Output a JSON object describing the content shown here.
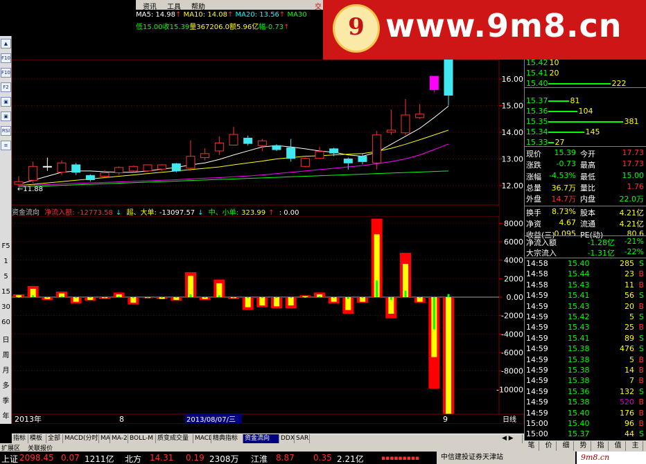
{
  "menubar": {
    "items": [
      "资讯",
      "工具",
      "帮助",
      "交"
    ]
  },
  "ma_line": {
    "ma5": "MA5: 14.98",
    "ma10": "MA10: 14.08",
    "ma20": "MA20: 13.56",
    "ma30": "MA30"
  },
  "info_line": {
    "low": "低15.00",
    "close": "收15.39",
    "vol": "量367206.0",
    "amount": "额5.96亿",
    "change": "幅-0.73"
  },
  "banner": {
    "seal_letter": "9",
    "site": "www.9m8.cn"
  },
  "left_tools": {
    "buttons": [
      "▲",
      "F10",
      "F10",
      "F2",
      "▣",
      "▣",
      "RSI",
      "≡"
    ],
    "labels": [
      "F5",
      "1",
      "5",
      "15",
      "30",
      "60",
      "日",
      "周",
      "月",
      "多",
      "季",
      "年"
    ]
  },
  "price_axis": [
    "16.00",
    "15.00",
    "14.00",
    "13.00",
    "12.00"
  ],
  "cf_axis": [
    "8000",
    "6000",
    "4000",
    "2000",
    "0.00",
    "-2000",
    "-4000",
    "-6000",
    "-8000",
    "-10000"
  ],
  "low_marker": "←11.88",
  "time_axis": {
    "left": "2013年",
    "mid": "8",
    "selected": "2013/08/07/三",
    "right": "9",
    "mode": "日线"
  },
  "capital_flow_header": {
    "title": "资金流向",
    "net_label": "净流入额:",
    "net_value": "-12773.58",
    "super_label": "超、大单:",
    "super_value": "-13097.57",
    "small_label": "中、小单:",
    "small_value": "323.99",
    "extra": ": 0.00"
  },
  "order_book": [
    {
      "price": "15.42",
      "vol": "10",
      "bar": 0
    },
    {
      "price": "15.41",
      "vol": "20",
      "bar": 0
    },
    {
      "price": "15.40",
      "vol": "222",
      "bar": 90
    },
    {
      "price": "15.37",
      "vol": "81",
      "bar": 30
    },
    {
      "price": "15.36",
      "vol": "104",
      "bar": 42
    },
    {
      "price": "15.35",
      "vol": "381",
      "bar": 108
    },
    {
      "price": "15.34",
      "vol": "145",
      "bar": 52
    },
    {
      "price": "15.33",
      "vol": "27",
      "bar": 8
    }
  ],
  "quote": [
    {
      "l": "现价",
      "v": "15.39",
      "vc": "green",
      "l2": "今开",
      "v2": "17.73",
      "v2c": "red"
    },
    {
      "l": "涨跌",
      "v": "-0.73",
      "vc": "green",
      "l2": "最高",
      "v2": "17.73",
      "v2c": "red"
    },
    {
      "l": "涨幅",
      "v": "-4.53%",
      "vc": "green",
      "l2": "最低",
      "v2": "15.00",
      "v2c": "green"
    },
    {
      "l": "总量",
      "v": "36.7万",
      "vc": "yellow",
      "l2": "量比",
      "v2": "1.76",
      "v2c": "red"
    },
    {
      "l": "外盘",
      "v": "14.7万",
      "vc": "red",
      "l2": "内盘",
      "v2": "22.0万",
      "v2c": "green"
    },
    {
      "l": "换手",
      "v": "8.73%",
      "vc": "yellow",
      "l2": "股本",
      "v2": "4.21亿",
      "v2c": "yellow"
    },
    {
      "l": "净资",
      "v": "4.67",
      "vc": "yellow",
      "l2": "流通",
      "v2": "4.21亿",
      "v2c": "yellow"
    },
    {
      "l": "收益(三)",
      "v": "0.095",
      "vc": "yellow",
      "l2": "PE(动)",
      "v2": "80.6",
      "v2c": "yellow"
    }
  ],
  "flow_summary": [
    {
      "l": "净流入额",
      "v": "-1.28亿",
      "p": "-21%"
    },
    {
      "l": "大宗流入",
      "v": "-1.31亿",
      "p": "-22%"
    }
  ],
  "trades": [
    {
      "t": "14:58",
      "p": "15.40",
      "pc": "green",
      "v": "285",
      "vc": "yellow",
      "s": "S",
      "sc": "green"
    },
    {
      "t": "14:58",
      "p": "15.44",
      "pc": "green",
      "v": "23",
      "vc": "yellow",
      "s": "B",
      "sc": "red"
    },
    {
      "t": "14:58",
      "p": "15.43",
      "pc": "green",
      "v": "11",
      "vc": "yellow",
      "s": "B",
      "sc": "red"
    },
    {
      "t": "14:59",
      "p": "15.41",
      "pc": "green",
      "v": "56",
      "vc": "yellow",
      "s": "S",
      "sc": "green"
    },
    {
      "t": "14:59",
      "p": "15.43",
      "pc": "green",
      "v": "20",
      "vc": "yellow",
      "s": "B",
      "sc": "red"
    },
    {
      "t": "14:59",
      "p": "15.42",
      "pc": "green",
      "v": "5",
      "vc": "yellow",
      "s": "S",
      "sc": "green"
    },
    {
      "t": "14:59",
      "p": "15.43",
      "pc": "green",
      "v": "25",
      "vc": "yellow",
      "s": "B",
      "sc": "red"
    },
    {
      "t": "14:59",
      "p": "15.41",
      "pc": "green",
      "v": "89",
      "vc": "yellow",
      "s": "S",
      "sc": "green"
    },
    {
      "t": "14:59",
      "p": "15.38",
      "pc": "green",
      "v": "476",
      "vc": "yellow",
      "s": "S",
      "sc": "green"
    },
    {
      "t": "14:59",
      "p": "15.38",
      "pc": "green",
      "v": "5",
      "vc": "yellow",
      "s": "B",
      "sc": "red"
    },
    {
      "t": "14:59",
      "p": "15.38",
      "pc": "green",
      "v": "14",
      "vc": "yellow",
      "s": "B",
      "sc": "red"
    },
    {
      "t": "14:59",
      "p": "15.38",
      "pc": "green",
      "v": "7",
      "vc": "yellow",
      "s": "B",
      "sc": "red"
    },
    {
      "t": "14:59",
      "p": "15.36",
      "pc": "green",
      "v": "132",
      "vc": "yellow",
      "s": "S",
      "sc": "green"
    },
    {
      "t": "14:59",
      "p": "15.38",
      "pc": "green",
      "v": "520",
      "vc": "magenta",
      "s": "B",
      "sc": "red"
    },
    {
      "t": "14:59",
      "p": "15.40",
      "pc": "green",
      "v": "176",
      "vc": "yellow",
      "s": "B",
      "sc": "red"
    },
    {
      "t": "15:00",
      "p": "15.40",
      "pc": "green",
      "v": "96",
      "vc": "yellow",
      "s": "B",
      "sc": "red"
    },
    {
      "t": "15:00",
      "p": "15.37",
      "pc": "green",
      "v": "44",
      "vc": "yellow",
      "s": "S",
      "sc": "green"
    },
    {
      "t": "15:00",
      "p": "15.39",
      "pc": "green",
      "v": "0",
      "vc": "yellow",
      "s": "",
      "sc": "green"
    }
  ],
  "tabs": [
    "指标",
    "模板",
    "全部",
    "MACD(分时",
    "MA",
    "MA-2",
    "BOLL-M",
    "质变成交量",
    "MACD",
    "精典指标",
    "资金流向",
    "DDX",
    "SAR"
  ],
  "active_tab": "资金流向",
  "expand": [
    "扩展区",
    "关联报价"
  ],
  "right_tabs": [
    "笔",
    "价",
    "细",
    "势",
    "指",
    "值",
    "主"
  ],
  "status": {
    "idx1_name": "上证",
    "idx1_val": "2098.45",
    "idx1_chg": "0.07",
    "idx1_amt": "1211亿",
    "idx2_name": "北方",
    "idx2_val": "14.31",
    "idx2_chg": "0.19",
    "idx2_amt": "2308万",
    "idx3_name": "江淮",
    "idx3_val": "8.87",
    "idx3_chg": "0.35",
    "idx3_amt": "2.21亿",
    "broker": "中信建投证券天津站",
    "signature": "9m8.cn"
  },
  "chart_data": [
    {
      "type": "candlestick",
      "title": "",
      "ylim": [
        11.6,
        17.0
      ],
      "yticks": [
        12,
        13,
        14,
        15,
        16
      ],
      "candles": [
        {
          "o": 12.15,
          "c": 12.05,
          "h": 12.35,
          "l": 11.95
        },
        {
          "o": 12.2,
          "c": 12.72,
          "h": 12.9,
          "l": 12.1
        },
        {
          "o": 12.72,
          "c": 12.72,
          "h": 13.05,
          "l": 12.55
        },
        {
          "o": 12.5,
          "c": 12.85,
          "h": 12.95,
          "l": 12.4
        },
        {
          "o": 12.78,
          "c": 12.5,
          "h": 12.85,
          "l": 12.4
        },
        {
          "o": 12.38,
          "c": 12.22,
          "h": 12.42,
          "l": 12.15
        },
        {
          "o": 12.35,
          "c": 12.48,
          "h": 12.58,
          "l": 12.3
        },
        {
          "o": 12.48,
          "c": 12.68,
          "h": 12.72,
          "l": 12.4
        },
        {
          "o": 12.55,
          "c": 12.72,
          "h": 12.75,
          "l": 12.5
        },
        {
          "o": 12.55,
          "c": 12.78,
          "h": 12.8,
          "l": 12.5
        },
        {
          "o": 12.62,
          "c": 12.78,
          "h": 12.8,
          "l": 12.55
        },
        {
          "o": 12.82,
          "c": 12.55,
          "h": 12.85,
          "l": 12.5
        },
        {
          "o": 12.65,
          "c": 13.1,
          "h": 13.7,
          "l": 12.55
        },
        {
          "o": 13.2,
          "c": 13.05,
          "h": 13.4,
          "l": 12.95
        },
        {
          "o": 13.3,
          "c": 13.6,
          "h": 13.85,
          "l": 13.15
        },
        {
          "o": 13.52,
          "c": 13.92,
          "h": 14.2,
          "l": 13.5
        },
        {
          "o": 13.78,
          "c": 13.58,
          "h": 13.88,
          "l": 13.5
        },
        {
          "o": 13.5,
          "c": 13.68,
          "h": 13.75,
          "l": 13.3
        },
        {
          "o": 13.5,
          "c": 13.35,
          "h": 13.55,
          "l": 13.3
        },
        {
          "o": 13.42,
          "c": 13.02,
          "h": 13.75,
          "l": 12.9
        },
        {
          "o": 12.72,
          "c": 13.02,
          "h": 13.05,
          "l": 12.7
        },
        {
          "o": 13.02,
          "c": 13.28,
          "h": 13.45,
          "l": 13.0
        },
        {
          "o": 13.38,
          "c": 13.22,
          "h": 13.42,
          "l": 13.1
        },
        {
          "o": 13.0,
          "c": 12.85,
          "h": 13.05,
          "l": 12.6
        },
        {
          "o": 13.1,
          "c": 12.9,
          "h": 13.2,
          "l": 12.8
        },
        {
          "o": 12.85,
          "c": 13.9,
          "h": 14.05,
          "l": 12.6
        },
        {
          "o": 14.0,
          "c": 14.08,
          "h": 14.85,
          "l": 13.9
        },
        {
          "o": 13.98,
          "c": 14.65,
          "h": 15.25,
          "l": 13.9
        },
        {
          "o": 14.55,
          "c": 14.68,
          "h": 15.05,
          "l": 14.5
        },
        {
          "o": 15.6,
          "c": 16.1,
          "h": 16.1,
          "l": 15.5
        },
        {
          "o": 17.73,
          "c": 15.39,
          "h": 17.73,
          "l": 15.0
        }
      ],
      "candle_colors": [
        "red",
        "red",
        "white",
        "red",
        "cyan",
        "cyan",
        "red",
        "red",
        "red",
        "red",
        "red",
        "cyan",
        "red",
        "red",
        "red",
        "red",
        "cyan",
        "red",
        "cyan",
        "cyan",
        "red",
        "red",
        "cyan",
        "cyan",
        "cyan",
        "red",
        "red",
        "red",
        "red",
        "magenta",
        "cyan"
      ],
      "ma_series": [
        {
          "name": "MA5",
          "color": "#ffffff",
          "values": [
            12.05,
            12.2,
            12.35,
            12.5,
            12.55,
            12.55,
            12.52,
            12.5,
            12.5,
            12.55,
            12.62,
            12.68,
            12.78,
            12.85,
            12.98,
            13.15,
            13.3,
            13.45,
            13.5,
            13.45,
            13.38,
            13.3,
            13.25,
            13.15,
            13.1,
            13.25,
            13.55,
            13.85,
            14.15,
            14.55,
            14.98
          ]
        },
        {
          "name": "MA10",
          "color": "#ffff00",
          "values": [
            12.0,
            12.05,
            12.1,
            12.15,
            12.2,
            12.25,
            12.3,
            12.35,
            12.4,
            12.45,
            12.5,
            12.55,
            12.6,
            12.65,
            12.7,
            12.78,
            12.85,
            12.92,
            13.0,
            13.05,
            13.1,
            13.12,
            13.15,
            13.18,
            13.2,
            13.28,
            13.4,
            13.55,
            13.72,
            13.9,
            14.08
          ]
        },
        {
          "name": "MA20",
          "color": "#ff00ff",
          "values": [
            12.0,
            12.02,
            12.04,
            12.06,
            12.08,
            12.1,
            12.12,
            12.14,
            12.16,
            12.18,
            12.2,
            12.22,
            12.25,
            12.28,
            12.3,
            12.33,
            12.36,
            12.4,
            12.45,
            12.5,
            12.55,
            12.6,
            12.65,
            12.7,
            12.75,
            12.82,
            12.9,
            13.0,
            13.15,
            13.35,
            13.56
          ]
        },
        {
          "name": "MA30",
          "color": "#00ff00",
          "values": [
            11.95,
            11.97,
            11.99,
            12.01,
            12.03,
            12.05,
            12.07,
            12.09,
            12.11,
            12.13,
            12.15,
            12.17,
            12.19,
            12.21,
            12.23,
            12.25,
            12.27,
            12.29,
            12.31,
            12.33,
            12.35,
            12.37,
            12.39,
            12.41,
            12.43,
            12.45,
            12.47,
            12.49,
            12.51,
            12.53,
            12.55
          ]
        }
      ]
    },
    {
      "type": "bar",
      "title": "资金流向",
      "ylim": [
        -13000,
        8500
      ],
      "yticks": [
        8000,
        6000,
        4000,
        2000,
        0,
        -2000,
        -4000,
        -6000,
        -8000,
        -10000
      ],
      "series": [
        {
          "name": "净流入额",
          "values": [
            300,
            1200,
            -300,
            600,
            -700,
            -400,
            -200,
            500,
            -800,
            -100,
            -200,
            -400,
            2700,
            -300,
            1900,
            -200,
            -1400,
            -1100,
            -1200,
            -1200,
            200,
            500,
            -700,
            -1800,
            -600,
            8500,
            -2300,
            4800,
            -600,
            -9900,
            -13000
          ]
        },
        {
          "name": "超、大单",
          "values": [
            200,
            900,
            -200,
            400,
            -500,
            -300,
            -100,
            300,
            -600,
            -100,
            -200,
            -300,
            2300,
            -200,
            1500,
            -100,
            -1100,
            -900,
            -1000,
            -900,
            100,
            300,
            -500,
            -1400,
            -500,
            6800,
            -1800,
            3600,
            -500,
            -6500,
            -12773
          ]
        },
        {
          "name": "中、小单",
          "values": [
            0,
            200,
            0,
            100,
            -100,
            0,
            0,
            100,
            -100,
            0,
            0,
            0,
            300,
            0,
            200,
            0,
            -100,
            -100,
            -100,
            -100,
            0,
            100,
            -100,
            -200,
            -100,
            1800,
            -300,
            700,
            -100,
            -3500,
            324
          ]
        }
      ]
    }
  ]
}
